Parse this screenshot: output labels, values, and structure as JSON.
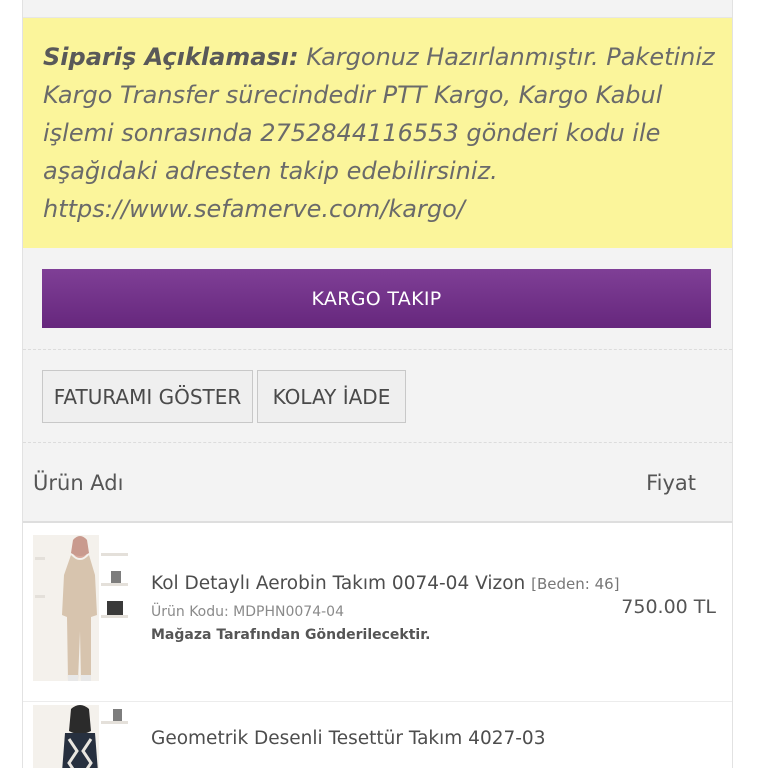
{
  "order_note": {
    "label": "Sipariş Açıklaması:",
    "text": " Kargonuz Hazırlanmıştır. Paketiniz Kargo Transfer sürecindedir PTT Kargo, Kargo Kabul işlemi sonrasında 2752844116553 gönderi kodu ile aşağıdaki adresten takip edebilirsiniz. https://www.sefamerve.com/kargo/"
  },
  "buttons": {
    "track_shipment": "KARGO TAKIP",
    "show_invoice": "FATURAMI GÖSTER",
    "easy_return": "KOLAY İADE"
  },
  "table": {
    "col_product": "Ürün Adı",
    "col_price": "Fiyat"
  },
  "products": [
    {
      "name": "Kol Detaylı Aerobin Takım 0074-04 Vizon ",
      "size": "[Beden: 46]",
      "code": "Ürün Kodu: MDPHN0074-04",
      "shipping": "Mağaza Tarafından Gönderilecektir.",
      "price": "750.00 TL"
    },
    {
      "name": "Geometrik Desenli Tesettür Takım 4027-03"
    }
  ],
  "colors": {
    "note_bg": "#fbf59b",
    "primary_button": "#722f8b"
  }
}
